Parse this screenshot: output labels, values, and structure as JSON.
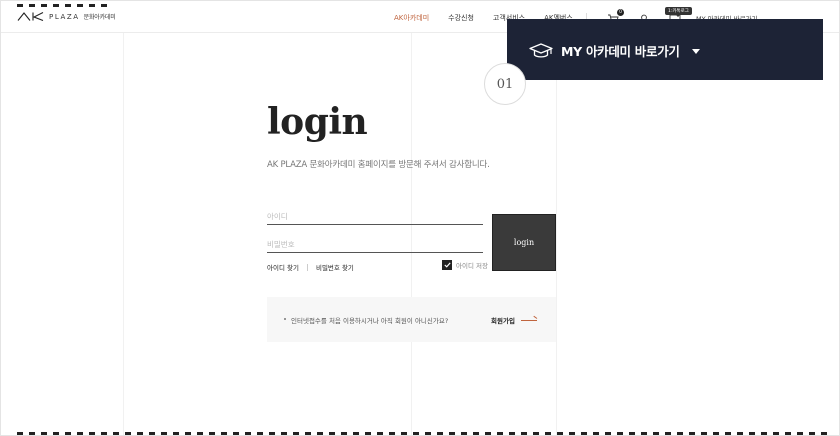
{
  "header": {
    "logo_plaza": "PLAZA",
    "logo_sub": "문화아카데미",
    "nav": [
      {
        "label": "AK아카데미",
        "active": true
      },
      {
        "label": "수강신청",
        "active": false
      },
      {
        "label": "고객서비스",
        "active": false
      },
      {
        "label": "AK멤버스",
        "active": false
      }
    ],
    "icons": [
      {
        "name": "cart-icon",
        "count": "0"
      },
      {
        "name": "user-icon",
        "count": ""
      },
      {
        "name": "talk-icon",
        "count": ""
      }
    ],
    "talk_tooltip": "1:카톡로그",
    "my_academy_top": "MY 아카데미 바로가기"
  },
  "my_panel": {
    "label": "MY 아카데미 바로가기"
  },
  "step_number": "01",
  "login": {
    "title": "login",
    "welcome": "AK PLAZA 문화아카데미 홈페이지를 방문해 주셔서 감사합니다.",
    "id_placeholder": "아이디",
    "pw_placeholder": "비밀번호",
    "button_label": "login",
    "find_id": "아이디 찾기",
    "find_pw": "비밀번호 찾기",
    "save_id": "아이디 저장",
    "save_id_checked": true
  },
  "join": {
    "text": "인터넷접수를 처음 이용하시거나 아직 회원이 아니신가요?",
    "link": "회원가입"
  },
  "colors": {
    "accent": "#c0643e",
    "panel": "#1d2336",
    "button": "#3a3a3a"
  }
}
